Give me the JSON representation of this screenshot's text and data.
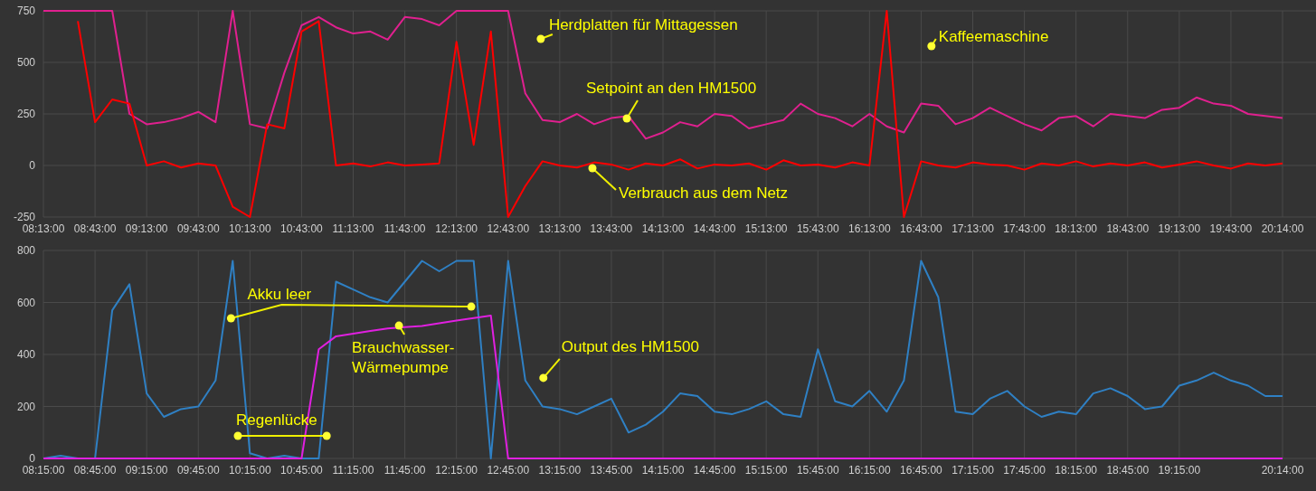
{
  "charts": [
    {
      "chart_data": {
        "type": "line",
        "categories": [
          "08:13:00",
          null,
          null,
          "08:43:00",
          null,
          null,
          "09:13:00",
          null,
          null,
          "09:43:00",
          null,
          null,
          "10:13:00",
          null,
          null,
          "10:43:00",
          null,
          null,
          "11:13:00",
          null,
          null,
          "11:43:00",
          null,
          null,
          "12:13:00",
          null,
          null,
          "12:43:00",
          null,
          null,
          "13:13:00",
          null,
          null,
          "13:43:00",
          null,
          null,
          "14:13:00",
          null,
          null,
          "14:43:00",
          null,
          null,
          "15:13:00",
          null,
          null,
          "15:43:00",
          null,
          null,
          "16:13:00",
          null,
          null,
          "16:43:00",
          null,
          null,
          "17:13:00",
          null,
          null,
          "17:43:00",
          null,
          null,
          "18:13:00",
          null,
          null,
          "18:43:00",
          null,
          null,
          "19:13:00",
          null,
          null,
          "19:43:00",
          null,
          null,
          "20:14:00"
        ],
        "series": [
          {
            "color": "#e0208f",
            "values": [
              750,
              750,
              750,
              750,
              750,
              250,
              200,
              210,
              230,
              260,
              210,
              750,
              200,
              180,
              450,
              680,
              720,
              670,
              640,
              650,
              610,
              720,
              710,
              680,
              750,
              750,
              750,
              750,
              350,
              220,
              210,
              250,
              200,
              230,
              240,
              130,
              160,
              210,
              190,
              250,
              240,
              180,
              200,
              220,
              300,
              250,
              230,
              190,
              250,
              190,
              160,
              300,
              290,
              200,
              230,
              280,
              240,
              200,
              170,
              230,
              240,
              190,
              250,
              240,
              230,
              270,
              280,
              330,
              300,
              290,
              250,
              240,
              230
            ]
          },
          {
            "color": "#ff0000",
            "values": [
              null,
              null,
              700,
              210,
              320,
              300,
              0,
              20,
              -10,
              10,
              0,
              -200,
              -250,
              200,
              180,
              650,
              700,
              0,
              10,
              -5,
              15,
              0,
              5,
              10,
              600,
              100,
              650,
              -250,
              -100,
              20,
              0,
              -10,
              15,
              5,
              -20,
              10,
              0,
              30,
              -15,
              5,
              0,
              10,
              -20,
              25,
              0,
              5,
              -10,
              15,
              0,
              750,
              -250,
              20,
              0,
              -10,
              15,
              5,
              0,
              -20,
              10,
              0,
              20,
              -5,
              10,
              0,
              15,
              -10,
              5,
              20,
              0,
              -15,
              10,
              0,
              10
            ]
          }
        ],
        "ylim": [
          -250,
          750
        ],
        "yticks": [
          750,
          500,
          250,
          0,
          -250
        ],
        "grid": true,
        "annotations": [
          "Herdplatten für Mittagessen",
          "Kaffeemaschine",
          "Setpoint an den HM1500",
          "Verbrauch aus dem Netz"
        ]
      }
    },
    {
      "chart_data": {
        "type": "line",
        "categories": [
          "08:15:00",
          null,
          null,
          "08:45:00",
          null,
          null,
          "09:15:00",
          null,
          null,
          "09:45:00",
          null,
          null,
          "10:15:00",
          null,
          null,
          "10:45:00",
          null,
          null,
          "11:15:00",
          null,
          null,
          "11:45:00",
          null,
          null,
          "12:15:00",
          null,
          null,
          "12:45:00",
          null,
          null,
          "13:15:00",
          null,
          null,
          "13:45:00",
          null,
          null,
          "14:15:00",
          null,
          null,
          "14:45:00",
          null,
          null,
          "15:15:00",
          null,
          null,
          "15:45:00",
          null,
          null,
          "16:15:00",
          null,
          null,
          "16:45:00",
          null,
          null,
          "17:15:00",
          null,
          null,
          "17:45:00",
          null,
          null,
          "18:15:00",
          null,
          null,
          "18:45:00",
          null,
          null,
          "19:15:00",
          null,
          null,
          null,
          null,
          null,
          "20:14:00"
        ],
        "series": [
          {
            "color": "#2f80c4",
            "values": [
              0,
              10,
              0,
              0,
              570,
              670,
              250,
              160,
              190,
              200,
              300,
              760,
              20,
              0,
              10,
              0,
              0,
              680,
              650,
              620,
              600,
              680,
              760,
              720,
              760,
              760,
              0,
              760,
              300,
              200,
              190,
              170,
              200,
              230,
              100,
              130,
              180,
              250,
              240,
              180,
              170,
              190,
              220,
              170,
              160,
              420,
              220,
              200,
              260,
              180,
              300,
              760,
              620,
              180,
              170,
              230,
              260,
              200,
              160,
              180,
              170,
              250,
              270,
              240,
              190,
              200,
              280,
              300,
              330,
              300,
              280,
              240,
              240
            ]
          },
          {
            "color": "#e020e0",
            "values": [
              0,
              0,
              0,
              0,
              0,
              0,
              0,
              0,
              0,
              0,
              0,
              0,
              0,
              0,
              0,
              0,
              420,
              470,
              480,
              490,
              500,
              505,
              510,
              520,
              530,
              540,
              550,
              0,
              0,
              0,
              0,
              0,
              0,
              0,
              0,
              0,
              0,
              0,
              0,
              0,
              0,
              0,
              0,
              0,
              0,
              0,
              0,
              0,
              0,
              0,
              0,
              0,
              0,
              0,
              0,
              0,
              0,
              0,
              0,
              0,
              0,
              0,
              0,
              0,
              0,
              0,
              0,
              0,
              0,
              0,
              0,
              0,
              0
            ]
          }
        ],
        "ylim": [
          0,
          800
        ],
        "yticks": [
          800,
          600,
          400,
          200,
          0
        ],
        "grid": true,
        "annotations": [
          "Akku leer",
          "Brauchwasser-\nWärmepumpe",
          "Output des HM1500",
          "Regenlücke"
        ]
      }
    }
  ]
}
